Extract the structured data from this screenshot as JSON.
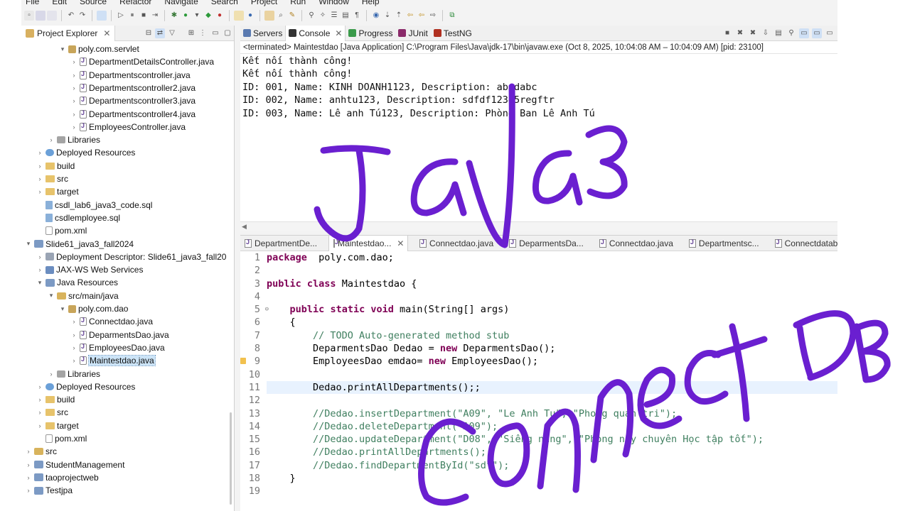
{
  "menu": [
    "File",
    "Edit",
    "Source",
    "Refactor",
    "Navigate",
    "Search",
    "Project",
    "Run",
    "Window",
    "Help"
  ],
  "explorer": {
    "tab_label": "Project Explorer",
    "close_label": "✕",
    "tree": [
      {
        "label": "poly.com.servlet",
        "icon": "package-icon",
        "indent": 3,
        "twisty": "▾"
      },
      {
        "label": "DepartmentDetailsController.java",
        "icon": "java-file-icon",
        "indent": 4,
        "twisty": "›"
      },
      {
        "label": "Departmentscontroller.java",
        "icon": "java-file-icon",
        "indent": 4,
        "twisty": "›"
      },
      {
        "label": "Departmentscontroller2.java",
        "icon": "java-file-icon",
        "indent": 4,
        "twisty": "›"
      },
      {
        "label": "Departmentscontroller3.java",
        "icon": "java-file-icon",
        "indent": 4,
        "twisty": "›"
      },
      {
        "label": "Departmentscontroller4.java",
        "icon": "java-file-icon",
        "indent": 4,
        "twisty": "›"
      },
      {
        "label": "EmployeesController.java",
        "icon": "java-file-icon",
        "indent": 4,
        "twisty": "›"
      },
      {
        "label": "Libraries",
        "icon": "library-icon",
        "indent": 2,
        "twisty": "›"
      },
      {
        "label": "Deployed Resources",
        "icon": "deployed-resources-icon",
        "indent": 1,
        "twisty": "›"
      },
      {
        "label": "build",
        "icon": "folder-icon",
        "indent": 1,
        "twisty": "›"
      },
      {
        "label": "src",
        "icon": "folder-icon",
        "indent": 1,
        "twisty": "›"
      },
      {
        "label": "target",
        "icon": "folder-icon",
        "indent": 1,
        "twisty": "›"
      },
      {
        "label": "csdl_lab6_java3_code.sql",
        "icon": "sql-file-icon",
        "indent": 1,
        "twisty": ""
      },
      {
        "label": "csdlemployee.sql",
        "icon": "sql-file-icon",
        "indent": 1,
        "twisty": ""
      },
      {
        "label": "pom.xml",
        "icon": "xml-file-icon",
        "indent": 1,
        "twisty": ""
      },
      {
        "label": "Slide61_java3_fall2024",
        "icon": "project-icon",
        "indent": 0,
        "twisty": "▾"
      },
      {
        "label": "Deployment Descriptor: Slide61_java3_fall20",
        "icon": "deployment-descriptor-icon",
        "indent": 1,
        "twisty": "›"
      },
      {
        "label": "JAX-WS Web Services",
        "icon": "web-services-icon",
        "indent": 1,
        "twisty": "›"
      },
      {
        "label": "Java Resources",
        "icon": "java-resources-icon",
        "indent": 1,
        "twisty": "▾"
      },
      {
        "label": "src/main/java",
        "icon": "source-folder-icon",
        "indent": 2,
        "twisty": "▾"
      },
      {
        "label": "poly.com.dao",
        "icon": "package-icon",
        "indent": 3,
        "twisty": "▾"
      },
      {
        "label": "Connectdao.java",
        "icon": "java-file-icon",
        "indent": 4,
        "twisty": "›"
      },
      {
        "label": "DeparmentsDao.java",
        "icon": "java-file-icon",
        "indent": 4,
        "twisty": "›"
      },
      {
        "label": "EmployeesDao.java",
        "icon": "java-file-icon",
        "indent": 4,
        "twisty": "›"
      },
      {
        "label": "Maintestdao.java",
        "icon": "java-file-icon",
        "indent": 4,
        "twisty": "›",
        "selected": true
      },
      {
        "label": "Libraries",
        "icon": "library-icon",
        "indent": 2,
        "twisty": "›"
      },
      {
        "label": "Deployed Resources",
        "icon": "deployed-resources-icon",
        "indent": 1,
        "twisty": "›"
      },
      {
        "label": "build",
        "icon": "folder-icon",
        "indent": 1,
        "twisty": "›"
      },
      {
        "label": "src",
        "icon": "folder-icon",
        "indent": 1,
        "twisty": "›"
      },
      {
        "label": "target",
        "icon": "folder-icon",
        "indent": 1,
        "twisty": "›"
      },
      {
        "label": "pom.xml",
        "icon": "xml-file-icon",
        "indent": 1,
        "twisty": ""
      },
      {
        "label": "src",
        "icon": "source-folder-icon",
        "indent": 0,
        "twisty": "›"
      },
      {
        "label": "StudentManagement",
        "icon": "project-icon",
        "indent": 0,
        "twisty": "›"
      },
      {
        "label": "taoprojectweb",
        "icon": "project-icon",
        "indent": 0,
        "twisty": "›"
      },
      {
        "label": "Testjpa",
        "icon": "project-icon",
        "indent": 0,
        "twisty": "›"
      }
    ]
  },
  "console": {
    "tabs": [
      {
        "label": "Servers",
        "icon": "servers-icon"
      },
      {
        "label": "Console",
        "icon": "console-icon",
        "active": true
      },
      {
        "label": "Progress",
        "icon": "progress-icon"
      },
      {
        "label": "JUnit",
        "icon": "junit-icon"
      },
      {
        "label": "TestNG",
        "icon": "testng-icon"
      }
    ],
    "close_label": "✕",
    "status": "<terminated> Maintestdao [Java Application] C:\\Program Files\\Java\\jdk-17\\bin\\javaw.exe  (Oct 8, 2025, 10:04:08 AM – 10:04:09 AM) [pid: 23100]",
    "output": [
      "Kết nối thành công!",
      "Kết nối thành công!",
      "ID: 001, Name: KINH DOANH1123, Description: abcdabc",
      "ID: 002, Name: anhtu123, Description: sdfdf12345regftr",
      "ID: 003, Name: Lê anh Tú123, Description: Phòng Ban Lê Anh Tú"
    ]
  },
  "editor": {
    "tabs": [
      {
        "label": "DepartmentDe...",
        "active": false
      },
      {
        "label": "Maintestdao...",
        "active": true,
        "close": "✕"
      },
      {
        "label": "Connectdao.java",
        "active": false
      },
      {
        "label": "DeparmentsDa...",
        "active": false
      },
      {
        "label": "Connectdao.java",
        "active": false
      },
      {
        "label": "Departmentsc...",
        "active": false
      },
      {
        "label": "Connectdatab...",
        "active": false
      }
    ],
    "lines": [
      {
        "n": "1",
        "tokens": [
          [
            "kw",
            "package"
          ],
          [
            "",
            "  poly.com.dao;"
          ]
        ]
      },
      {
        "n": "2",
        "tokens": []
      },
      {
        "n": "3",
        "tokens": [
          [
            "kw",
            "public"
          ],
          [
            "",
            " "
          ],
          [
            "kw",
            "class"
          ],
          [
            "",
            " Maintestdao {"
          ]
        ]
      },
      {
        "n": "4",
        "tokens": []
      },
      {
        "n": "5",
        "fold": "⊖",
        "tokens": [
          [
            "",
            "    "
          ],
          [
            "kw",
            "public"
          ],
          [
            "",
            " "
          ],
          [
            "kw",
            "static"
          ],
          [
            "",
            " "
          ],
          [
            "kw",
            "void"
          ],
          [
            "",
            " main(String[] args)"
          ]
        ]
      },
      {
        "n": "6",
        "tokens": [
          [
            "",
            "    {"
          ]
        ]
      },
      {
        "n": "7",
        "tokens": [
          [
            "",
            "        "
          ],
          [
            "cm",
            "// TODO Auto-generated method stub"
          ]
        ]
      },
      {
        "n": "8",
        "tokens": [
          [
            "",
            "        DeparmentsDao Dedao = "
          ],
          [
            "kw",
            "new"
          ],
          [
            "",
            " DeparmentsDao();"
          ]
        ]
      },
      {
        "n": "9",
        "warn": true,
        "tokens": [
          [
            "",
            "        EmployeesDao emdao= "
          ],
          [
            "kw",
            "new"
          ],
          [
            "",
            " EmployeesDao();"
          ]
        ]
      },
      {
        "n": "10",
        "tokens": []
      },
      {
        "n": "11",
        "current": true,
        "tokens": [
          [
            "",
            "        Dedao.printAllDepartments();;"
          ]
        ]
      },
      {
        "n": "12",
        "tokens": []
      },
      {
        "n": "13",
        "tokens": [
          [
            "",
            "        "
          ],
          [
            "cm",
            "//Dedao.insertDepartment(\"A09\", \"Le Anh Tu\", \"Phong quan tri\");"
          ]
        ]
      },
      {
        "n": "14",
        "tokens": [
          [
            "",
            "        "
          ],
          [
            "cm",
            "//Dedao.deleteDepartment(\"A09\");"
          ]
        ]
      },
      {
        "n": "15",
        "tokens": [
          [
            "",
            "        "
          ],
          [
            "cm",
            "//Dedao.updateDepartment(\"D08\", \"Siêng năng\", \"Phòng này chuyên Học tập tốt\");"
          ]
        ]
      },
      {
        "n": "16",
        "tokens": [
          [
            "",
            "        "
          ],
          [
            "cm",
            "//Dedao.printAllDepartments();"
          ]
        ]
      },
      {
        "n": "17",
        "tokens": [
          [
            "",
            "        "
          ],
          [
            "cm",
            "//Dedao.findDepartmentById(\"sdf\");"
          ]
        ]
      },
      {
        "n": "18",
        "tokens": [
          [
            "",
            "    }"
          ]
        ]
      },
      {
        "n": "19",
        "tokens": []
      }
    ]
  },
  "colors": {
    "handwriting": "#6a1fd0",
    "selection": "#cce4f7",
    "current_line": "#e8f2fe"
  }
}
